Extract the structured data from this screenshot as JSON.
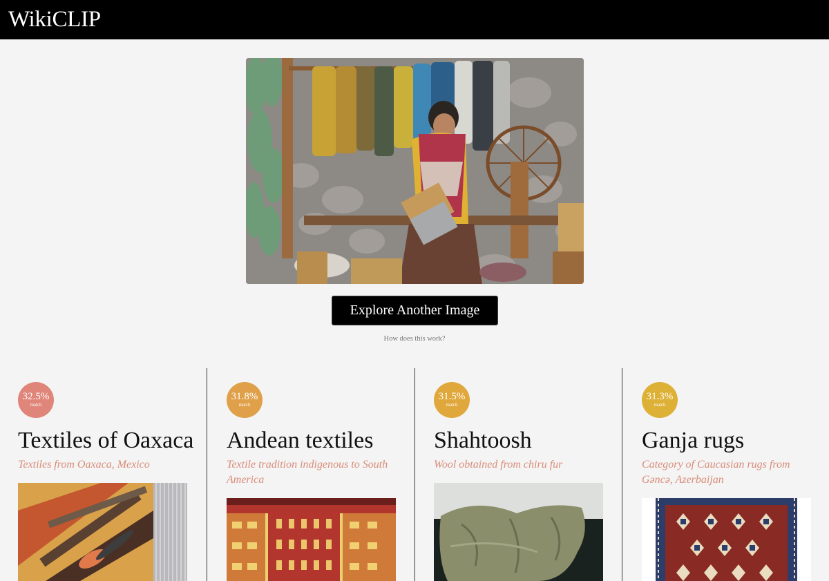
{
  "app": {
    "title": "WikiCLIP"
  },
  "hero": {
    "alt": "Woman carding wool beside hanging dyed yarn and a spinning wheel"
  },
  "actions": {
    "explore_label": "Explore Another Image",
    "how_label": "How does this work?"
  },
  "results": [
    {
      "match_pct": "32.5%",
      "match_label": "match",
      "badge_color": "#e0857a",
      "title": "Textiles of Oaxaca",
      "description": "Textiles from Oaxaca, Mexico"
    },
    {
      "match_pct": "31.8%",
      "match_label": "match",
      "badge_color": "#e0a04a",
      "title": "Andean textiles",
      "description": "Textile tradition indigenous to South America"
    },
    {
      "match_pct": "31.5%",
      "match_label": "match",
      "badge_color": "#e0a83c",
      "title": "Shahtoosh",
      "description": "Wool obtained from chiru fur"
    },
    {
      "match_pct": "31.3%",
      "match_label": "match",
      "badge_color": "#ddb036",
      "title": "Ganja rugs",
      "description": "Category of Caucasian rugs from Gəncə, Azerbaijan"
    }
  ],
  "colors": {
    "header_bg": "#000000",
    "page_bg": "#f4f4f4",
    "description_text": "#d98c78"
  }
}
